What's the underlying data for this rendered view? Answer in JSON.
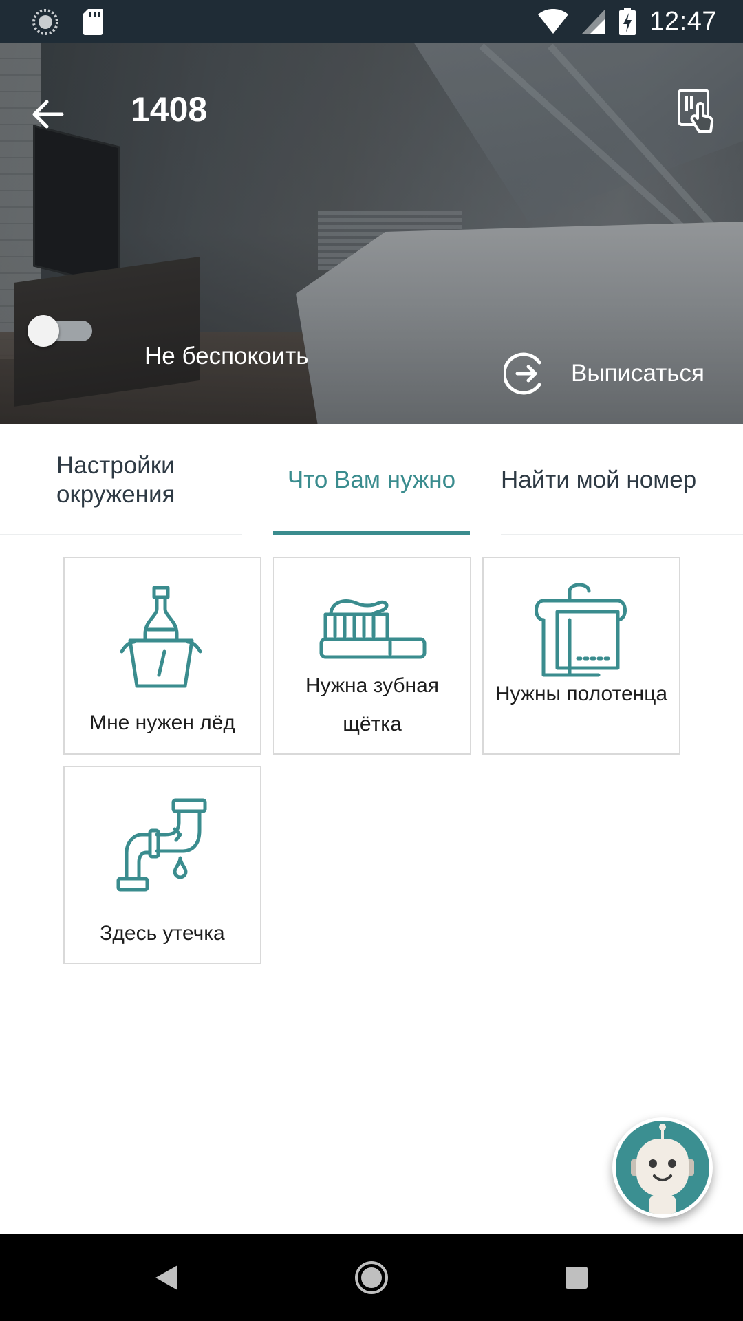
{
  "status_bar": {
    "time": "12:47",
    "icons": [
      "sync-icon",
      "sd-card-icon",
      "wifi-icon",
      "signal-icon",
      "battery-charging-icon"
    ]
  },
  "header": {
    "room_number": "1408",
    "back_icon": "arrow-left-icon",
    "action_icon": "touch-key-icon"
  },
  "controls": {
    "do_not_disturb": {
      "label": "Не беспокоить",
      "enabled": false
    },
    "checkout": {
      "label": "Выписаться",
      "icon": "exit-circle-icon"
    }
  },
  "tabs": [
    {
      "label": "Настройки окружения",
      "active": false
    },
    {
      "label": "Что Вам нужно",
      "active": true
    },
    {
      "label": "Найти мой номер",
      "active": false
    }
  ],
  "requests": [
    {
      "label": "Мне нужен лёд",
      "icon": "ice-bucket-icon"
    },
    {
      "label": "Нужна зубная щётка",
      "icon": "toothbrush-icon"
    },
    {
      "label": "Нужны полотенца",
      "icon": "towel-icon"
    },
    {
      "label": "Здесь утечка",
      "icon": "leaking-pipe-icon"
    }
  ],
  "chatbot": {
    "icon": "robot-icon"
  },
  "colors": {
    "accent": "#3a8c8e",
    "status_bar": "#1f2c36",
    "tile_border": "#d9d9d9",
    "nav_bar": "#000000"
  }
}
